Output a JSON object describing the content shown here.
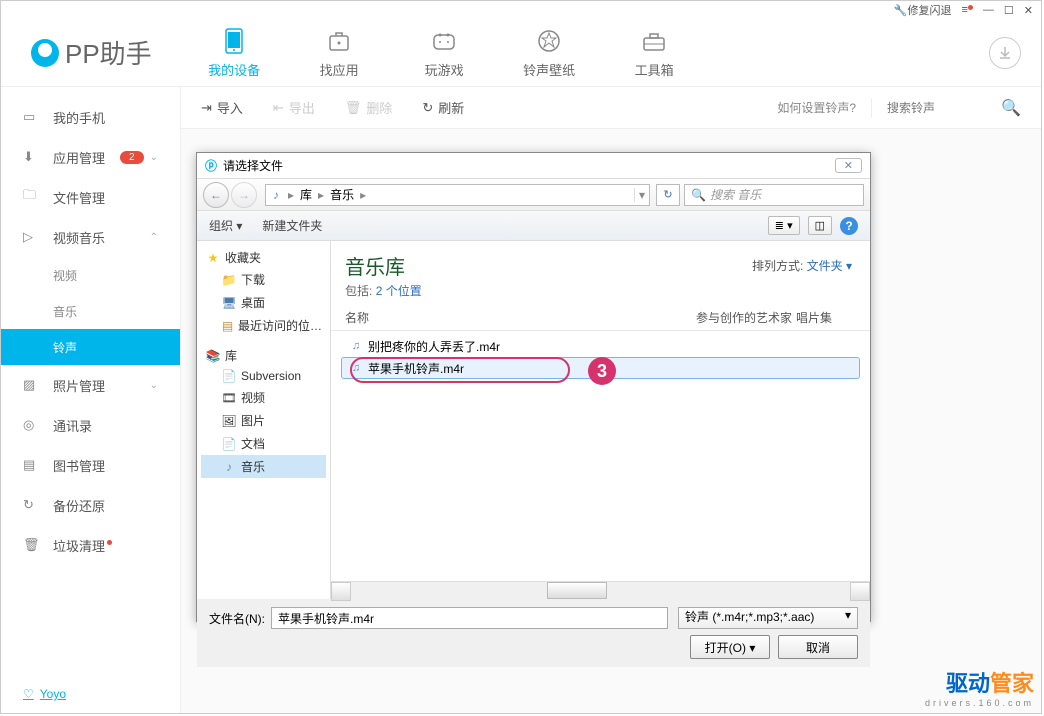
{
  "titlebar": {
    "repair": "修复闪退"
  },
  "logo": "PP助手",
  "nav": [
    {
      "label": "我的设备",
      "active": true
    },
    {
      "label": "找应用"
    },
    {
      "label": "玩游戏"
    },
    {
      "label": "铃声壁纸"
    },
    {
      "label": "工具箱"
    }
  ],
  "sidebar": {
    "items": [
      {
        "label": "我的手机"
      },
      {
        "label": "应用管理",
        "badge": "2",
        "expandable": true
      },
      {
        "label": "文件管理"
      },
      {
        "label": "视频音乐",
        "expanded": true
      },
      {
        "label": "照片管理",
        "expandable": true
      },
      {
        "label": "通讯录"
      },
      {
        "label": "图书管理"
      },
      {
        "label": "备份还原"
      },
      {
        "label": "垃圾清理",
        "dot": true
      }
    ],
    "subs": [
      {
        "label": "视频"
      },
      {
        "label": "音乐"
      },
      {
        "label": "铃声",
        "active": true
      }
    ]
  },
  "toolbar": {
    "import": "导入",
    "export": "导出",
    "delete": "删除",
    "refresh": "刷新",
    "help": "如何设置铃声?",
    "search_placeholder": "搜索铃声"
  },
  "dialog": {
    "title": "请选择文件",
    "breadcrumb": {
      "root": "库",
      "current": "音乐"
    },
    "search_placeholder": "搜索 音乐",
    "organize": "组织",
    "new_folder": "新建文件夹",
    "tree": {
      "fav": "收藏夹",
      "downloads": "下载",
      "desktop": "桌面",
      "recent": "最近访问的位…",
      "library": "库",
      "subversion": "Subversion",
      "video": "视频",
      "pictures": "图片",
      "documents": "文档",
      "music": "音乐"
    },
    "header": {
      "title": "音乐库",
      "sub_prefix": "包括:",
      "sub_count": "2 个位置",
      "sort_label": "排列方式:",
      "sort_value": "文件夹"
    },
    "columns": {
      "name": "名称",
      "artist": "参与创作的艺术家",
      "album": "唱片集"
    },
    "files": [
      {
        "name": "别把疼你的人弄丢了.m4r"
      },
      {
        "name": "苹果手机铃声.m4r",
        "selected": true
      }
    ],
    "footer": {
      "fn_label": "文件名(N):",
      "fn_value": "苹果手机铃声.m4r",
      "filter": "铃声 (*.m4r;*.mp3;*.aac)",
      "open": "打开(O)",
      "cancel": "取消"
    }
  },
  "callout": "3",
  "yoyo": "Yoyo",
  "watermark": {
    "main1": "驱动",
    "main2": "管家",
    "sub": "drivers.160.com"
  }
}
